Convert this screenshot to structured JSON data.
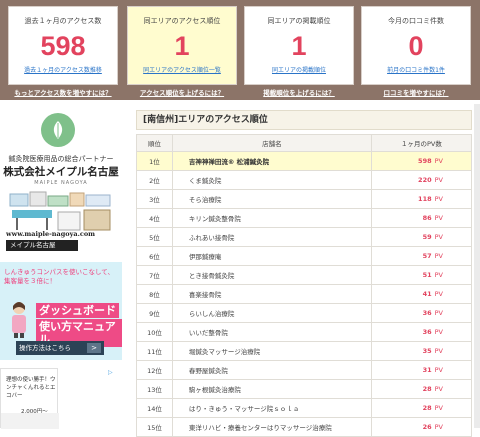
{
  "stats": {
    "cards": [
      {
        "title": "過去１ヶ月のアクセス数",
        "value": "598",
        "link": "過去１ヶ月のアクセス数推移"
      },
      {
        "title": "同エリアのアクセス順位",
        "value": "1",
        "link": "同エリアのアクセス順位一覧"
      },
      {
        "title": "同エリアの掲載順位",
        "value": "1",
        "link": "同エリアの掲載順位"
      },
      {
        "title": "今月の口コミ件数",
        "value": "0",
        "link": "前月の口コミ件数1件"
      }
    ],
    "more_links": [
      "もっとアクセス数を増やすには？",
      "アクセス順位を上げるには？",
      "掲載順位を上げるには？",
      "口コミを増やすには？"
    ]
  },
  "sidebar": {
    "ad1": {
      "tagline": "鍼灸院医療用品の総合パートナー",
      "company": "株式会社メイプル名古屋",
      "roman": "MAIPLE NAGOYA",
      "url": "www.maiple-nagoya.com",
      "button": "メイプル名古屋"
    },
    "compass": {
      "headline": "しんきゅうコンパスを使いこなして、集客量を３倍に！",
      "title1": "ダッシュボード",
      "title2": "使い方マニュアル",
      "button": "操作方法はこちら",
      "button_arrow": ">"
    },
    "ad2": {
      "text": "理想の使い勝手！ウンチャくんれるとエコバー",
      "price": "2,000円～",
      "mark": "▷"
    }
  },
  "ranking": {
    "title": "[南信州]エリアのアクセス順位",
    "headers": {
      "rank": "順位",
      "name": "店舗名",
      "pv": "１ヶ月のPV数"
    },
    "pv_unit": "PV",
    "rows": [
      {
        "rank": "1位",
        "name": "吉神神禅田流® 松浦鍼灸院",
        "pv": "598"
      },
      {
        "rank": "2位",
        "name": "くま鍼灸院",
        "pv": "220"
      },
      {
        "rank": "3位",
        "name": "そら治療院",
        "pv": "118"
      },
      {
        "rank": "4位",
        "name": "キリン鍼灸整骨院",
        "pv": "86"
      },
      {
        "rank": "5位",
        "name": "ふれあい接骨院",
        "pv": "59"
      },
      {
        "rank": "6位",
        "name": "伊那鍼療庵",
        "pv": "57"
      },
      {
        "rank": "7位",
        "name": "とき接骨鍼灸院",
        "pv": "51"
      },
      {
        "rank": "8位",
        "name": "喜楽接骨院",
        "pv": "41"
      },
      {
        "rank": "9位",
        "name": "らいしん治療院",
        "pv": "36"
      },
      {
        "rank": "10位",
        "name": "いいだ整骨院",
        "pv": "36"
      },
      {
        "rank": "11位",
        "name": "堀鍼灸マッサージ治療院",
        "pv": "35"
      },
      {
        "rank": "12位",
        "name": "春野屋鍼灸院",
        "pv": "31"
      },
      {
        "rank": "13位",
        "name": "駒ヶ根鍼灸治療院",
        "pv": "28"
      },
      {
        "rank": "14位",
        "name": "はり・きゅう・マッサージ院ｓｏｌａ",
        "pv": "28"
      },
      {
        "rank": "15位",
        "name": "東洋リハビ・療養センターはりマッサージ治療院",
        "pv": "26"
      }
    ]
  },
  "colors": {
    "accent": "#e2435e",
    "band": "#8c7468",
    "highlight": "#fffccf",
    "link": "#2a74c8"
  }
}
